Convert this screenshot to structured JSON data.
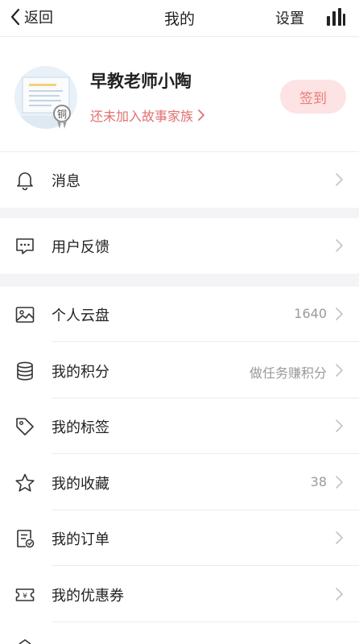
{
  "header": {
    "back_label": "返回",
    "title": "我的",
    "settings_label": "设置"
  },
  "profile": {
    "name": "早教老师小陶",
    "medal_text": "铜",
    "family_text": "还未加入故事家族",
    "signin_label": "签到"
  },
  "menu": {
    "message": {
      "label": "消息",
      "icon": "bell-icon"
    },
    "feedback": {
      "label": "用户反馈",
      "icon": "chat-bubble-icon"
    },
    "cloud": {
      "label": "个人云盘",
      "value": "1640",
      "icon": "image-icon"
    },
    "points": {
      "label": "我的积分",
      "value": "做任务赚积分",
      "icon": "database-icon"
    },
    "tags": {
      "label": "我的标签",
      "icon": "tag-icon"
    },
    "favorites": {
      "label": "我的收藏",
      "value": "38",
      "icon": "star-icon"
    },
    "orders": {
      "label": "我的订单",
      "icon": "order-icon"
    },
    "coupons": {
      "label": "我的优惠券",
      "icon": "coupon-icon"
    }
  },
  "colors": {
    "accent": "#e36f6f",
    "signin_bg": "#fde3e3",
    "section_gap": "#f4f4f6",
    "muted_text": "#9a9a9a"
  }
}
